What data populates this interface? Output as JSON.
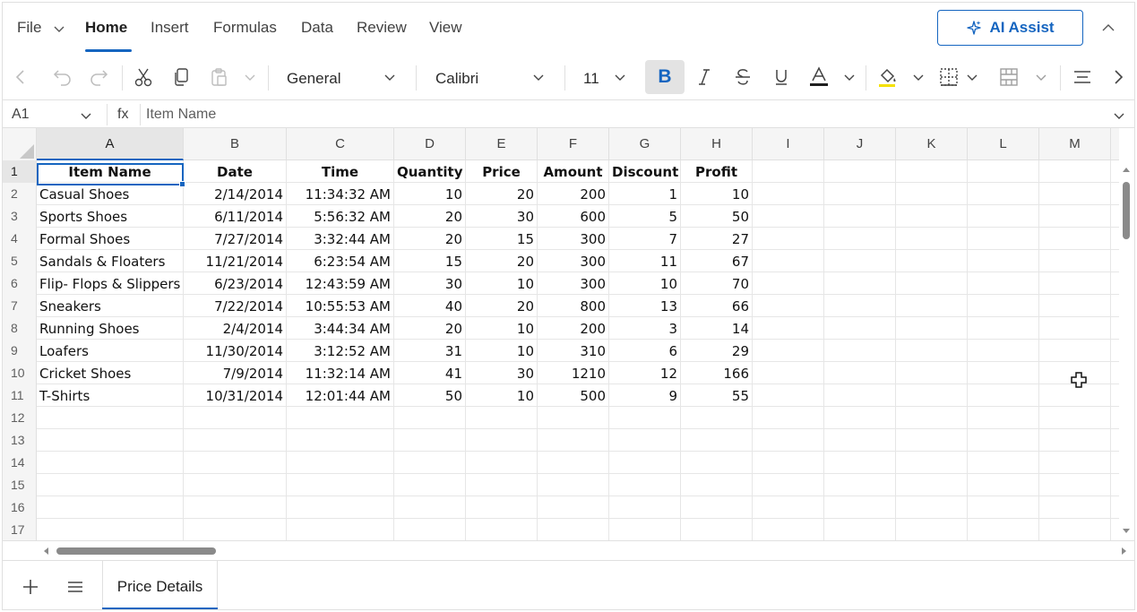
{
  "ribbon": {
    "tabs": [
      "File",
      "Home",
      "Insert",
      "Formulas",
      "Data",
      "Review",
      "View"
    ],
    "active_tab": "Home",
    "ai_assist_label": "AI Assist"
  },
  "toolbar": {
    "number_format": "General",
    "font_family": "Calibri",
    "font_size": "11",
    "bold_label": "B"
  },
  "formula_bar": {
    "cell_ref": "A1",
    "fx_label": "fx",
    "value": "Item Name"
  },
  "grid": {
    "columns": [
      "A",
      "B",
      "C",
      "D",
      "E",
      "F",
      "G",
      "H",
      "I",
      "J",
      "K",
      "L",
      "M"
    ],
    "row_numbers": [
      "1",
      "2",
      "3",
      "4",
      "5",
      "6",
      "7",
      "8",
      "9",
      "10",
      "11",
      "12",
      "13",
      "14",
      "15",
      "16",
      "17"
    ],
    "header": [
      "Item Name",
      "Date",
      "Time",
      "Quantity",
      "Price",
      "Amount",
      "Discount",
      "Profit"
    ],
    "rows": [
      [
        "Casual Shoes",
        "2/14/2014",
        "11:34:32 AM",
        "10",
        "20",
        "200",
        "1",
        "10"
      ],
      [
        "Sports Shoes",
        "6/11/2014",
        "5:56:32 AM",
        "20",
        "30",
        "600",
        "5",
        "50"
      ],
      [
        "Formal Shoes",
        "7/27/2014",
        "3:32:44 AM",
        "20",
        "15",
        "300",
        "7",
        "27"
      ],
      [
        "Sandals & Floaters",
        "11/21/2014",
        "6:23:54 AM",
        "15",
        "20",
        "300",
        "11",
        "67"
      ],
      [
        "Flip- Flops & Slippers",
        "6/23/2014",
        "12:43:59 AM",
        "30",
        "10",
        "300",
        "10",
        "70"
      ],
      [
        "Sneakers",
        "7/22/2014",
        "10:55:53 AM",
        "40",
        "20",
        "800",
        "13",
        "66"
      ],
      [
        "Running Shoes",
        "2/4/2014",
        "3:44:34 AM",
        "20",
        "10",
        "200",
        "3",
        "14"
      ],
      [
        "Loafers",
        "11/30/2014",
        "3:12:52 AM",
        "31",
        "10",
        "310",
        "6",
        "29"
      ],
      [
        "Cricket Shoes",
        "7/9/2014",
        "11:32:14 AM",
        "41",
        "30",
        "1210",
        "12",
        "166"
      ],
      [
        "T-Shirts",
        "10/31/2014",
        "12:01:44 AM",
        "50",
        "10",
        "500",
        "9",
        "55"
      ]
    ]
  },
  "sheets": {
    "active": "Price Details"
  },
  "colors": {
    "accent": "#1565c0",
    "grid_line": "#e6e6e6",
    "header_bg": "#f5f5f5"
  }
}
